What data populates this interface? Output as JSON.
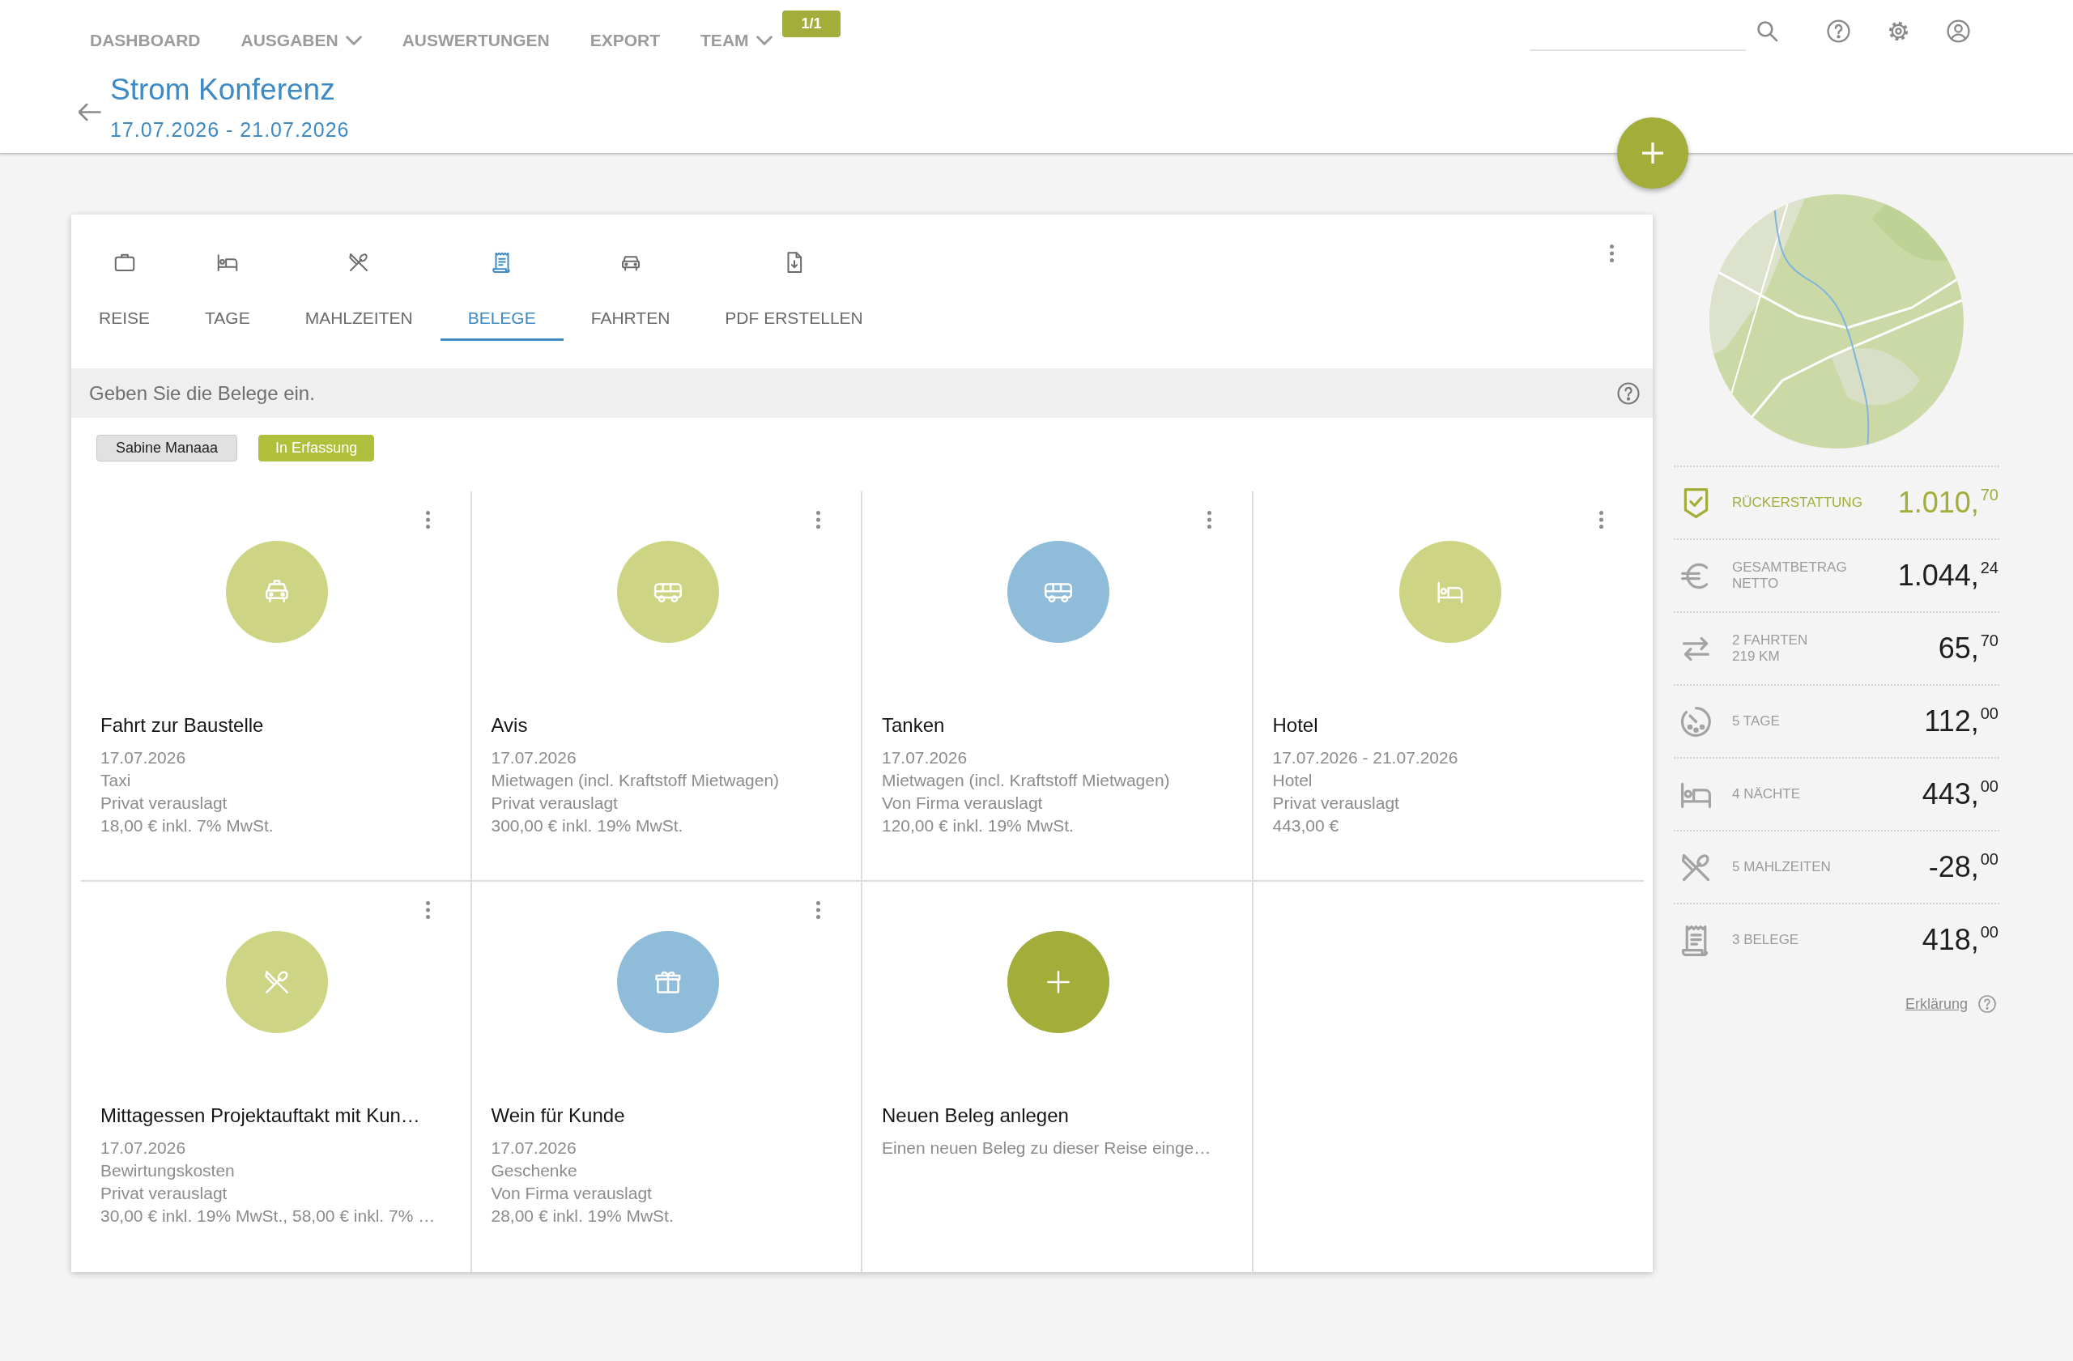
{
  "nav": {
    "items": [
      {
        "label": "DASHBOARD",
        "dropdown": false
      },
      {
        "label": "AUSGABEN",
        "dropdown": true
      },
      {
        "label": "AUSWERTUNGEN",
        "dropdown": false
      },
      {
        "label": "EXPORT",
        "dropdown": false
      },
      {
        "label": "TEAM",
        "dropdown": true,
        "badge": "1/1"
      }
    ]
  },
  "trip": {
    "title": "Strom Konferenz",
    "dates": "17.07.2026 - 21.07.2026"
  },
  "tabs": [
    {
      "label": "REISE",
      "selected": false
    },
    {
      "label": "TAGE",
      "selected": false
    },
    {
      "label": "MAHLZEITEN",
      "selected": false
    },
    {
      "label": "BELEGE",
      "selected": true
    },
    {
      "label": "FAHRTEN",
      "selected": false
    },
    {
      "label": "PDF ERSTELLEN",
      "selected": false
    }
  ],
  "hint": "Geben Sie die Belege ein.",
  "tags": [
    {
      "kind": "person",
      "label": "Sabine Manaaa"
    },
    {
      "kind": "status",
      "label": "In Erfassung"
    }
  ],
  "receipts": [
    {
      "kind": "receipt",
      "color": "#cdd585",
      "title": "Fahrt zur Baustelle",
      "date": "17.07.2026",
      "category": "Taxi",
      "paid_by": "Privat verauslagt",
      "amount": "18,00 € inkl. 7% MwSt."
    },
    {
      "kind": "receipt",
      "color": "#cdd585",
      "title": "Avis",
      "date": "17.07.2026",
      "category": "Mietwagen (incl. Kraftstoff Mietwagen)",
      "paid_by": "Privat verauslagt",
      "amount": "300,00 € inkl. 19% MwSt."
    },
    {
      "kind": "receipt",
      "color": "#8fbcd9",
      "title": "Tanken",
      "date": "17.07.2026",
      "category": "Mietwagen (incl. Kraftstoff Mietwagen)",
      "paid_by": "Von Firma verauslagt",
      "amount": "120,00 € inkl. 19% MwSt."
    },
    {
      "kind": "receipt",
      "color": "#cdd585",
      "title": "Hotel",
      "date": "17.07.2026 - 21.07.2026",
      "category": "Hotel",
      "paid_by": "Privat verauslagt",
      "amount": "443,00 €"
    },
    {
      "kind": "receipt",
      "color": "#cdd585",
      "title": "Mittagessen Projektauftakt mit Kun…",
      "date": "17.07.2026",
      "category": "Bewirtungskosten",
      "paid_by": "Privat verauslagt",
      "amount": "30,00 € inkl. 19% MwSt., 58,00 € inkl. 7% …"
    },
    {
      "kind": "receipt",
      "color": "#8fbcd9",
      "title": "Wein für Kunde",
      "date": "17.07.2026",
      "category": "Geschenke",
      "paid_by": "Von Firma verauslagt",
      "amount": "28,00 € inkl. 19% MwSt."
    },
    {
      "kind": "add",
      "color": "#a2ad3a",
      "title": "Neuen Beleg anlegen",
      "description": "Einen neuen Beleg zu dieser Reise einge…"
    }
  ],
  "summary": {
    "rows": [
      {
        "label": [
          "RÜCKERSTATTUNG"
        ],
        "value": "1.010,$^{70}$",
        "highlight": true
      },
      {
        "label": [
          "GESAMTBETRAG",
          "NETTO"
        ],
        "value": "1.044,$^{24}$",
        "highlight": false
      },
      {
        "label": [
          "2 FAHRTEN",
          "219 KM"
        ],
        "value": "65,$^{70}$",
        "highlight": false
      },
      {
        "label": [
          "5 TAGE"
        ],
        "value": "112,$^{00}$",
        "highlight": false
      },
      {
        "label": [
          "4 NÄCHTE"
        ],
        "value": "443,$^{00}$",
        "highlight": false
      },
      {
        "label": [
          "5 MAHLZEITEN"
        ],
        "value": "-28,$^{00}$",
        "highlight": false
      },
      {
        "label": [
          "3 BELEGE"
        ],
        "value": "418,$^{00}$",
        "highlight": false
      }
    ],
    "link": "Erklärung"
  }
}
